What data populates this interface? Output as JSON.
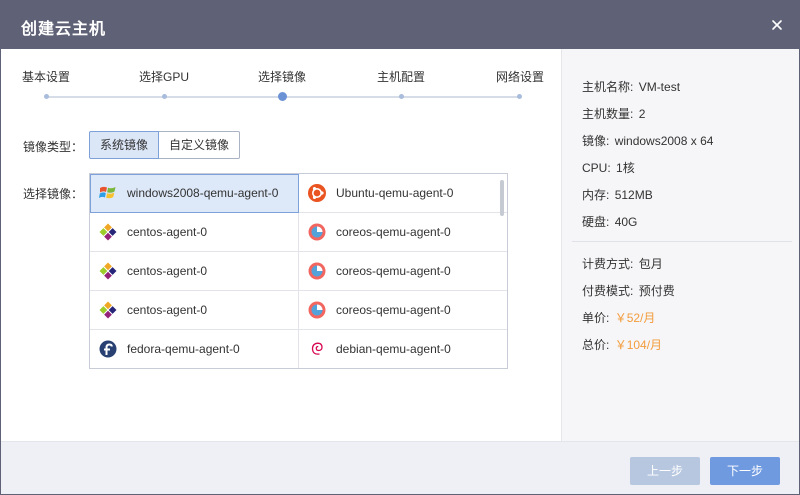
{
  "dialog": {
    "title": "创建云主机"
  },
  "steps": [
    "基本设置",
    "选择GPU",
    "选择镜像",
    "主机配置",
    "网络设置"
  ],
  "active_step": 2,
  "image_type": {
    "label": "镜像类型：",
    "options": [
      "系统镜像",
      "自定义镜像"
    ],
    "selected": 0
  },
  "image_select": {
    "label": "选择镜像：",
    "items": [
      {
        "name": "windows2008-qemu-agent-0",
        "icon": "windows-icon",
        "selected": true
      },
      {
        "name": "Ubuntu-qemu-agent-0",
        "icon": "ubuntu-icon",
        "selected": false
      },
      {
        "name": "centos-agent-0",
        "icon": "centos-icon",
        "selected": false
      },
      {
        "name": "coreos-qemu-agent-0",
        "icon": "coreos-icon",
        "selected": false
      },
      {
        "name": "centos-agent-0",
        "icon": "centos-icon",
        "selected": false
      },
      {
        "name": "coreos-qemu-agent-0",
        "icon": "coreos-icon",
        "selected": false
      },
      {
        "name": "centos-agent-0",
        "icon": "centos-icon",
        "selected": false
      },
      {
        "name": "coreos-qemu-agent-0",
        "icon": "coreos-icon",
        "selected": false
      },
      {
        "name": "fedora-qemu-agent-0",
        "icon": "fedora-icon",
        "selected": false
      },
      {
        "name": "debian-qemu-agent-0",
        "icon": "debian-icon",
        "selected": false
      }
    ]
  },
  "summary": {
    "host_name": {
      "k": "主机名称:",
      "v": "VM-test"
    },
    "host_count": {
      "k": "主机数量:",
      "v": "2"
    },
    "image": {
      "k": "镜像:",
      "v": "windows2008 x 64"
    },
    "cpu": {
      "k": "CPU:",
      "v": "1核"
    },
    "memory": {
      "k": "内存:",
      "v": "512MB"
    },
    "disk": {
      "k": "硬盘:",
      "v": "40G"
    },
    "billing": {
      "k": "计费方式:",
      "v": "包月"
    },
    "payment": {
      "k": "付费模式:",
      "v": "预付费"
    },
    "unit_price": {
      "k": "单价:",
      "v": "￥52/月"
    },
    "total_price": {
      "k": "总价:",
      "v": "￥104/月"
    }
  },
  "footer": {
    "prev": "上一步",
    "next": "下一步"
  },
  "colors": {
    "titlebar": "#5f6277",
    "accent": "#6f9ae0",
    "price": "#f39c3c"
  }
}
